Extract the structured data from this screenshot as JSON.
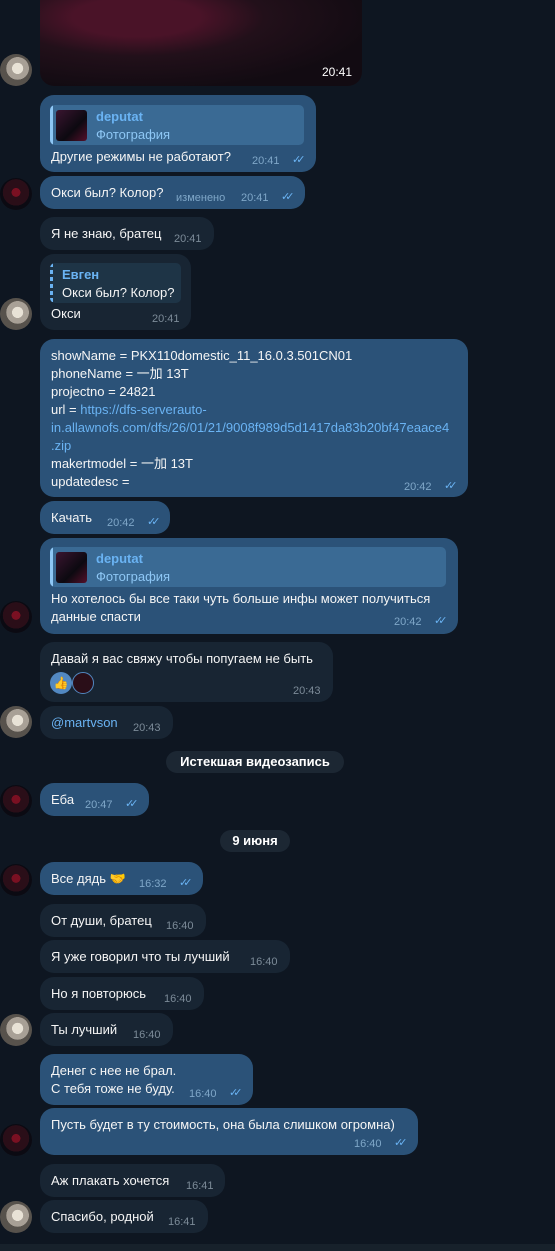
{
  "top_media": {
    "time": "20:41"
  },
  "messages": [
    {
      "reply_name": "deputat",
      "reply_text": "Фотография",
      "text": "Другие режимы не работают?",
      "time": "20:41"
    },
    {
      "text": "Окси был? Колор?",
      "edited": "изменено",
      "time": "20:41"
    },
    {
      "text": "Я не знаю, братец",
      "time": "20:41"
    },
    {
      "reply_name": "Евген",
      "reply_text": "Окси был? Колор?",
      "text": "Окси",
      "time": "20:41"
    },
    {
      "lines": {
        "l1": "showName = PKX110domestic_11_16.0.3.501CN01",
        "l2": "phoneName = 一加 13T",
        "l3": "projectno = 24821",
        "l4_prefix": "url = ",
        "l4_link": "https://dfs-serverauto-",
        "l5_link": "in.allawnofs.com/dfs/26/01/21/9008f989d5d1417da83b20bf47eaace4",
        "l6_link": ".zip",
        "l7": "makertmodel = 一加 13T",
        "l8": "updatedesc ="
      },
      "time": "20:42"
    },
    {
      "text": "Качать",
      "time": "20:42"
    },
    {
      "reply_name": "deputat",
      "reply_text": "Фотография",
      "line1": "Но хотелось бы все таки чуть больше инфы может получиться",
      "line2": "данные спасти",
      "time": "20:42"
    },
    {
      "text": "Давай я вас свяжу чтобы попугаем не быть",
      "reaction": "👍",
      "time": "20:43"
    },
    {
      "mention": "@martvson",
      "time": "20:43"
    },
    {
      "text": "Еба",
      "time": "20:47"
    },
    {
      "text": "Все дядь 🤝",
      "time": "16:32"
    },
    {
      "text": "От души, братец",
      "time": "16:40"
    },
    {
      "text": "Я уже говорил что ты лучший",
      "time": "16:40"
    },
    {
      "text": "Но я повторюсь",
      "time": "16:40"
    },
    {
      "text": "Ты лучший",
      "time": "16:40"
    },
    {
      "line1": "Денег с нее не брал.",
      "line2": "С тебя тоже не буду.",
      "time": "16:40"
    },
    {
      "text": "Пусть будет в ту стоимость, она была слишком огромна)",
      "time": "16:40"
    },
    {
      "text": "Аж плакать хочется",
      "time": "16:41"
    },
    {
      "text": "Спасибо, родной",
      "time": "16:41"
    }
  ],
  "service": {
    "expired_video": "Истекшая видеозапись",
    "date": "9 июня"
  },
  "colors": {
    "background": "#0e1621",
    "incoming": "#182533",
    "outgoing": "#2b5278",
    "accent": "#6ab3f3"
  },
  "icons": {
    "read": "double-check-icon"
  }
}
